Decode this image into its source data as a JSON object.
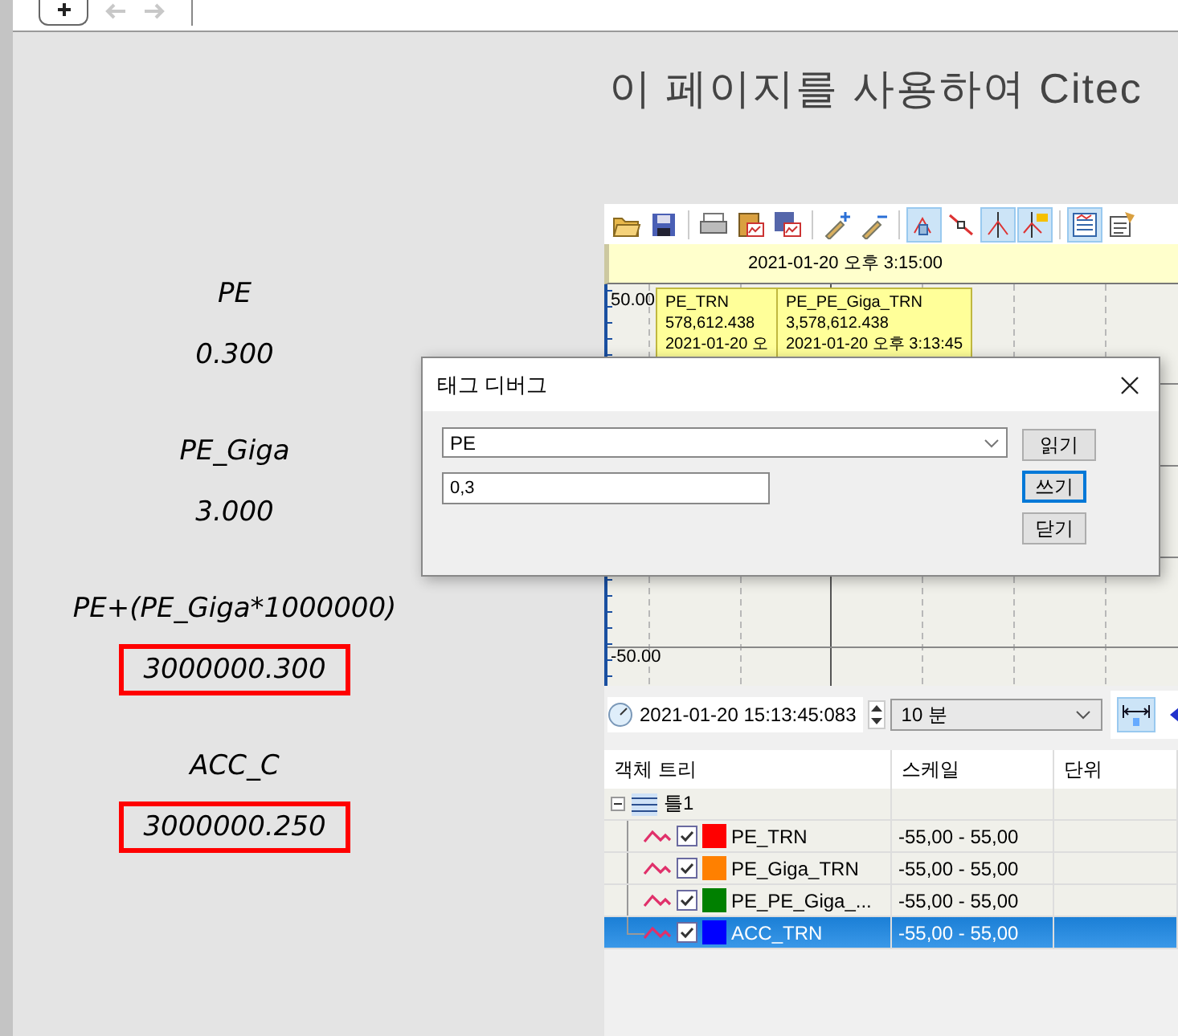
{
  "nav": {
    "buttons": [
      {
        "kind": "add"
      },
      {
        "kind": "back",
        "disabled": true
      },
      {
        "kind": "forward",
        "disabled": true
      }
    ]
  },
  "heading": "이 페이지를 사용하여 Citec",
  "readouts": [
    {
      "label": "PE",
      "value": "0.300",
      "highlighted": false
    },
    {
      "label": "PE_Giga",
      "value": "3.000",
      "highlighted": false
    },
    {
      "label": "PE+(PE_Giga*1000000)",
      "value": "3000000.300",
      "highlighted": true
    },
    {
      "label": "ACC_C",
      "value": "3000000.250",
      "highlighted": true
    }
  ],
  "trend": {
    "toolbar": [
      {
        "kind": "open",
        "selected": false
      },
      {
        "kind": "save",
        "selected": false
      },
      {
        "kind": "sep"
      },
      {
        "kind": "print",
        "selected": false
      },
      {
        "kind": "clipboard",
        "selected": false
      },
      {
        "kind": "save-chart",
        "selected": false
      },
      {
        "kind": "sep"
      },
      {
        "kind": "pen-add",
        "selected": false
      },
      {
        "kind": "pen-remove",
        "selected": false
      },
      {
        "kind": "sep"
      },
      {
        "kind": "cursor",
        "selected": true
      },
      {
        "kind": "line",
        "selected": false
      },
      {
        "kind": "cursor-v",
        "selected": true
      },
      {
        "kind": "cursor-flag",
        "selected": true
      },
      {
        "kind": "sep"
      },
      {
        "kind": "list",
        "selected": true
      },
      {
        "kind": "properties",
        "selected": false
      }
    ],
    "time_header": "2021-01-20 오후 3:15:00",
    "y_labels": [
      "50.00",
      "-50.00"
    ],
    "tooltips": [
      {
        "name": "PE_TRN",
        "value": "578,612.438",
        "time": "2021-01-20 오"
      },
      {
        "name": "PE_PE_Giga_TRN",
        "value": "3,578,612.438",
        "time": "2021-01-20 오후 3:13:45"
      }
    ],
    "time_field": "2021-01-20 15:13:45:083",
    "span": "10 분",
    "fit_on": true,
    "tree": {
      "columns": [
        "객체 트리",
        "스케일",
        "단위"
      ],
      "root": {
        "label": "틀1",
        "expanded": true,
        "children": [
          {
            "label": "PE_TRN",
            "checked": true,
            "color": "#ff0000",
            "scale": "-55,00 - 55,00",
            "selected": false
          },
          {
            "label": "PE_Giga_TRN",
            "checked": true,
            "color": "#ff8000",
            "scale": "-55,00 - 55,00",
            "selected": false
          },
          {
            "label": "PE_PE_Giga_...",
            "checked": true,
            "color": "#008000",
            "scale": "-55,00 - 55,00",
            "selected": false
          },
          {
            "label": "ACC_TRN",
            "checked": true,
            "color": "#0000ff",
            "scale": "-55,00 - 55,00",
            "selected": true
          }
        ]
      }
    }
  },
  "dialog": {
    "title": "태그 디버그",
    "tag": "PE",
    "value": "0,3",
    "buttons": [
      {
        "label": "읽기",
        "focused": false
      },
      {
        "label": "쓰기",
        "focused": true
      },
      {
        "label": "닫기",
        "focused": false
      }
    ]
  }
}
